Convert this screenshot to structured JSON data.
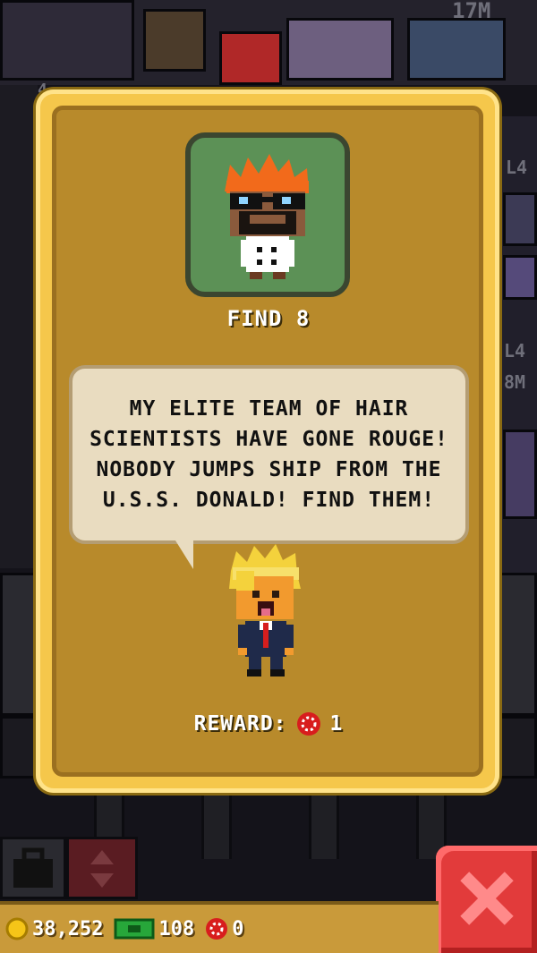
{
  "background": {
    "top_right_counter": "17M",
    "side_counters": [
      "4",
      "L4",
      "L4",
      "8M"
    ]
  },
  "quest": {
    "portrait_name": "hair scientist",
    "find_label": "FIND 8",
    "speech": "MY ELITE TEAM OF HAIR SCIENTISTS HAVE GONE ROUGE! NOBODY JUMPS SHIP FROM THE U.S.S. DONALD! FIND THEM!",
    "reward_label": "REWARD:",
    "reward_value": "1"
  },
  "status": {
    "coins": "38,252",
    "bux": "108",
    "chips": "0"
  },
  "colors": {
    "modal_frame": "#f5c74b",
    "modal_fill": "#b88a2b",
    "speech_bubble": "#e9dcc0",
    "close_button": "#e23b3b",
    "portrait_bg": "#5c9156"
  },
  "icons": {
    "coin": "coin-icon",
    "bux": "bux-icon",
    "chip": "chip-icon",
    "close": "close-icon",
    "bag": "bag-icon",
    "updown": "up-down-icon"
  }
}
